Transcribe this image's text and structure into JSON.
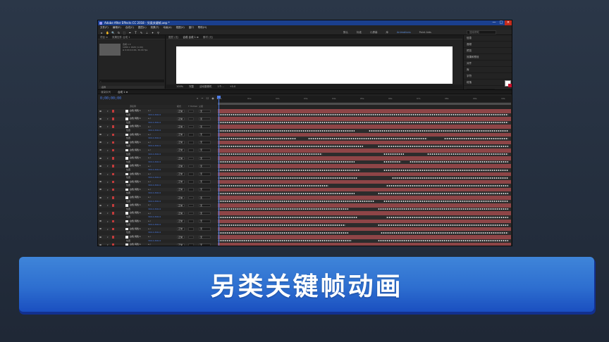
{
  "window": {
    "title": "Adobe After Effects CC 2018 - 另类关键帧.aep *",
    "controls": [
      "—",
      "□",
      "×"
    ]
  },
  "menu": [
    "文件(F)",
    "编辑(E)",
    "合成(C)",
    "图层(L)",
    "效果(T)",
    "动画(A)",
    "视图(V)",
    "窗口",
    "帮助(H)"
  ],
  "toolbar": {
    "tools": [
      "▸",
      "✋",
      "🔍",
      "↻",
      "⬚",
      "✒",
      "T",
      "✎",
      "⊥",
      "✦",
      "⚲"
    ],
    "workspaces": [
      {
        "label": "默认",
        "active": false
      },
      {
        "label": "标准",
        "active": false
      },
      {
        "label": "小屏幕",
        "active": false
      },
      {
        "label": "库",
        "active": false
      },
      {
        "label": "Animations",
        "active": true
      },
      {
        "label": "Paint Aids",
        "active": false
      }
    ],
    "search_placeholder": "搜索帮助"
  },
  "project": {
    "tabs": [
      "项目 ≡",
      "效果控件 合成 1"
    ],
    "thumb_info": [
      "合成 1 ▾",
      "1080 x 1920 (1.00)",
      "Δ 0;00;10;00, 30.00 fps"
    ],
    "search_icon": "⌕",
    "header": "名称"
  },
  "composition": {
    "tabs": [
      "图层 (无)",
      "合成 合成 1 ≡",
      "素材 (无)"
    ],
    "toolbar": [
      "100%",
      "完整",
      "活动摄像机",
      "1个…",
      "+0.0"
    ]
  },
  "right_panel": {
    "items": [
      "信息",
      "音频",
      "预览",
      "效果和预设",
      "对齐",
      "库",
      "字符",
      "段落"
    ],
    "font": "Arial",
    "style": "Black"
  },
  "timeline": {
    "tabs": [
      {
        "label": "渲染队列",
        "on": false
      },
      {
        "label": "合成 1 ≡",
        "on": true
      }
    ],
    "timecode": "0;00;00;00",
    "controls": [
      "⌕",
      "~",
      "☐",
      "◉",
      "⧉",
      "⊡"
    ],
    "ruler_ticks": [
      "0s",
      "01s",
      "02s",
      "03s",
      "04s",
      "05s",
      "06s",
      "07s",
      "08s",
      "09s",
      "10s"
    ],
    "columns": {
      "source": "源名称",
      "mode": "模式",
      "trk": "T TrkMat",
      "parent": "父级"
    },
    "layers": [
      {
        "name": "白色 纯色 1",
        "mode": "正常",
        "parent": "无",
        "prop": "位置",
        "value": "300.0,300.0",
        "keys": [
          [
            0,
            100
          ]
        ]
      },
      {
        "name": "白色 纯色 1",
        "mode": "正常",
        "parent": "无",
        "prop": "位置",
        "value": "300.0,300.0",
        "keys": [
          [
            0,
            100
          ]
        ]
      },
      {
        "name": "白色 纯色 1",
        "mode": "正常",
        "parent": "无",
        "prop": "位置",
        "value": "300.0,300.0",
        "keys": [
          [
            0,
            47
          ],
          [
            52,
            100
          ]
        ]
      },
      {
        "name": "白色 纯色 1",
        "mode": "正常",
        "parent": "无",
        "prop": "位置",
        "value": "300.0,300.0",
        "keys": [
          [
            0,
            27
          ],
          [
            31,
            72
          ],
          [
            78,
            100
          ]
        ]
      },
      {
        "name": "白色 纯色 1",
        "mode": "正常",
        "parent": "无",
        "prop": "位置",
        "value": "300.0,300.0",
        "keys": [
          [
            0,
            50
          ],
          [
            55,
            100
          ]
        ]
      },
      {
        "name": "白色 纯色 1",
        "mode": "正常",
        "parent": "无",
        "prop": "位置",
        "value": "300.0,300.0",
        "keys": [
          [
            0,
            36
          ],
          [
            57,
            64
          ],
          [
            72,
            100
          ]
        ]
      },
      {
        "name": "白色 纯色 1",
        "mode": "正常",
        "parent": "无",
        "prop": "位置",
        "value": "300.0,300.0",
        "keys": [
          [
            0,
            47
          ],
          [
            57,
            63
          ],
          [
            66,
            100
          ]
        ]
      },
      {
        "name": "白色 纯色 1",
        "mode": "正常",
        "parent": "无",
        "prop": "位置",
        "value": "300.0,300.0",
        "keys": [
          [
            0,
            49
          ],
          [
            57,
            100
          ]
        ]
      },
      {
        "name": "白色 纯色 1",
        "mode": "正常",
        "parent": "无",
        "prop": "位置",
        "value": "300.0,300.0",
        "keys": [
          [
            0,
            48
          ],
          [
            60,
            100
          ]
        ]
      },
      {
        "name": "白色 纯色 1",
        "mode": "正常",
        "parent": "无",
        "prop": "位置",
        "value": "300.0,300.0",
        "keys": [
          [
            0,
            38
          ],
          [
            58,
            100
          ]
        ]
      },
      {
        "name": "白色 纯色 1",
        "mode": "正常",
        "parent": "无",
        "prop": "位置",
        "value": "300.0,300.0",
        "keys": [
          [
            0,
            47
          ],
          [
            55,
            100
          ]
        ]
      },
      {
        "name": "白色 纯色 1",
        "mode": "正常",
        "parent": "无",
        "prop": "位置",
        "value": "300.0,300.0",
        "keys": [
          [
            0,
            54
          ],
          [
            57,
            100
          ]
        ]
      },
      {
        "name": "白色 纯色 1",
        "mode": "正常",
        "parent": "无",
        "prop": "位置",
        "value": "300.0,300.0",
        "keys": [
          [
            0,
            45
          ],
          [
            55,
            100
          ]
        ]
      },
      {
        "name": "白色 纯色 1",
        "mode": "正常",
        "parent": "无",
        "prop": "位置",
        "value": "300.0,300.0",
        "keys": [
          [
            0,
            48
          ],
          [
            58,
            100
          ]
        ]
      },
      {
        "name": "白色 纯色 1",
        "mode": "正常",
        "parent": "无",
        "prop": "位置",
        "value": "300.0,300.0",
        "keys": [
          [
            0,
            44
          ],
          [
            55,
            100
          ]
        ]
      },
      {
        "name": "白色 纯色 1",
        "mode": "正常",
        "parent": "无",
        "prop": "位置",
        "value": "300.0,300.0",
        "keys": [
          [
            0,
            45
          ],
          [
            56,
            100
          ]
        ]
      },
      {
        "name": "白色 纯色 1",
        "mode": "正常",
        "parent": "无",
        "prop": "位置",
        "value": "300.0,300.0",
        "keys": [
          [
            0,
            46
          ],
          [
            55,
            100
          ]
        ]
      },
      {
        "name": "白色 纯色 1",
        "mode": "正常",
        "parent": "无",
        "prop": "位置",
        "value": "300.0,300.0",
        "keys": [
          [
            0,
            44
          ],
          [
            56,
            100
          ]
        ]
      }
    ]
  },
  "banner": {
    "text": "另类关键帧动画",
    "color_top": "#3f85d9",
    "color_bottom": "#1a4fc0"
  }
}
